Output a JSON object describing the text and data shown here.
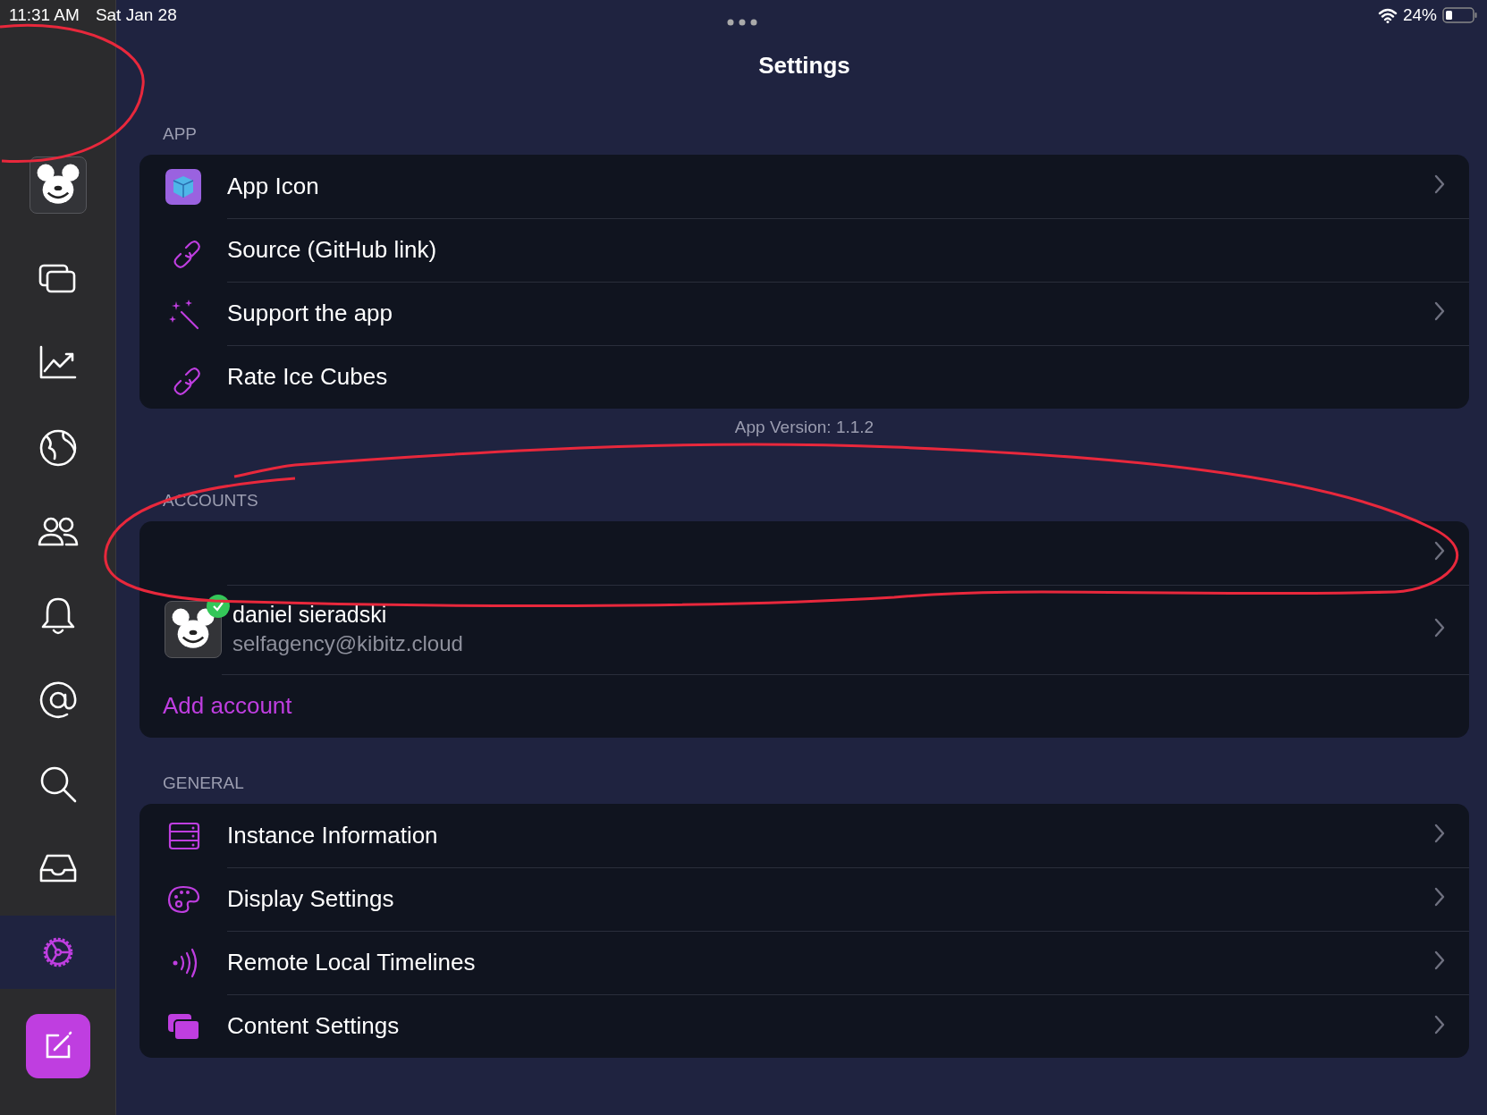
{
  "status_bar": {
    "time": "11:31 AM",
    "date": "Sat Jan 28",
    "battery": "24%"
  },
  "sidebar": {
    "items": [
      {
        "kind": "avatar",
        "selected": false
      },
      {
        "kind": "timeline",
        "selected": false
      },
      {
        "kind": "trending",
        "selected": false
      },
      {
        "kind": "explore",
        "selected": false
      },
      {
        "kind": "people",
        "selected": false
      },
      {
        "kind": "notifications",
        "selected": false
      },
      {
        "kind": "mentions",
        "selected": false
      },
      {
        "kind": "search",
        "selected": false
      },
      {
        "kind": "inbox",
        "selected": false
      },
      {
        "kind": "settings",
        "selected": true
      }
    ]
  },
  "title": "Settings",
  "sections": [
    {
      "header": "APP",
      "rows": [
        {
          "kind": "cube",
          "label": "App Icon",
          "chevron": true
        },
        {
          "kind": "link",
          "label": "Source (GitHub link)",
          "chevron": false
        },
        {
          "kind": "sparkles",
          "label": "Support the app",
          "chevron": true
        },
        {
          "kind": "link",
          "label": "Rate Ice Cubes",
          "chevron": false
        }
      ],
      "footer": "App Version: 1.1.2"
    },
    {
      "header": "ACCOUNTS",
      "rows": [
        {
          "kind": "empty",
          "chevron": true
        },
        {
          "kind": "account",
          "name": "daniel sieradski",
          "handle": "selfagency@kibitz.cloud",
          "verified": true,
          "chevron": true
        },
        {
          "kind": "action",
          "label": "Add account",
          "chevron": false
        }
      ]
    },
    {
      "header": "GENERAL",
      "rows": [
        {
          "kind": "server",
          "label": "Instance Information",
          "chevron": true
        },
        {
          "kind": "palette",
          "label": "Display Settings",
          "chevron": true
        },
        {
          "kind": "broadcast",
          "label": "Remote Local Timelines",
          "chevron": true
        },
        {
          "kind": "stack",
          "label": "Content Settings",
          "chevron": true
        }
      ]
    }
  ]
}
